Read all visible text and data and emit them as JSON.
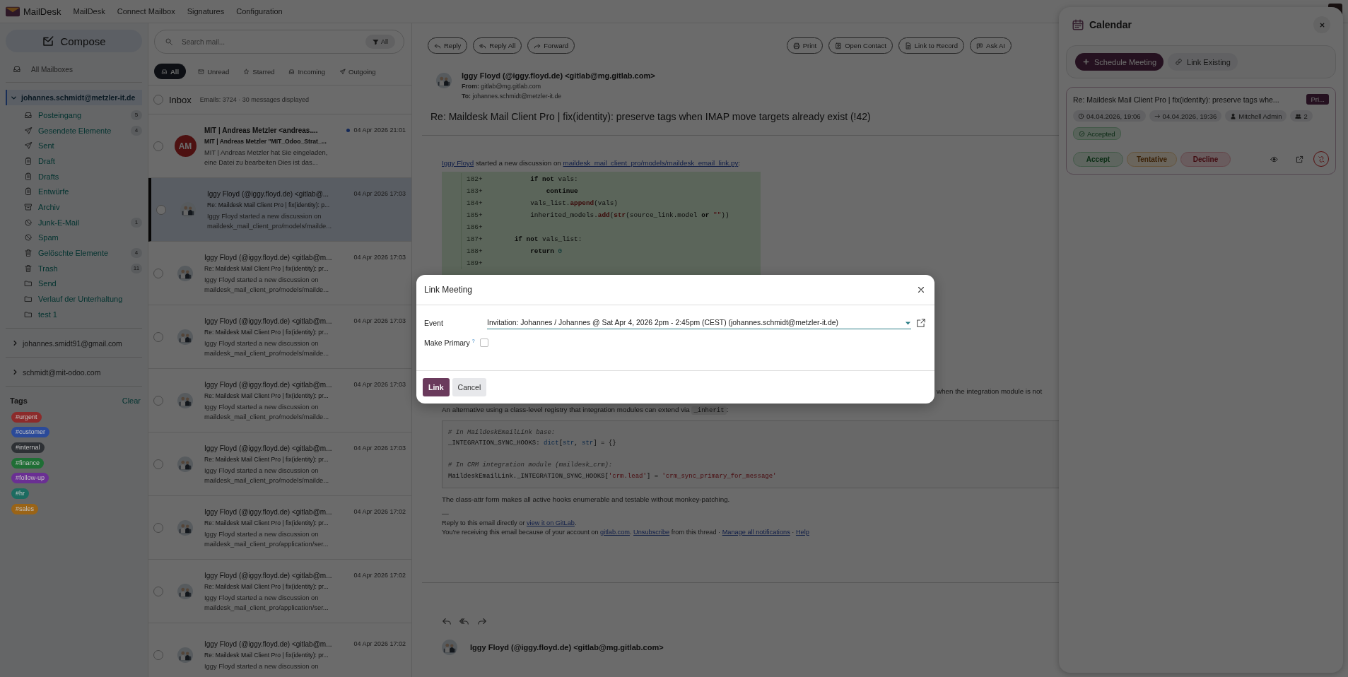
{
  "app": {
    "name": "MailDesk"
  },
  "nav": [
    {
      "label": "MailDesk"
    },
    {
      "label": "Connect Mailbox"
    },
    {
      "label": "Signatures"
    },
    {
      "label": "Configuration"
    }
  ],
  "sidebar": {
    "compose": "Compose",
    "all_mailboxes": "All Mailboxes",
    "accounts": [
      {
        "address": "johannes.schmidt@metzler-it.de",
        "expanded": true,
        "selected": true,
        "folders": [
          {
            "name": "Posteingang",
            "kind": "inbox",
            "count": "5"
          },
          {
            "name": "Gesendete Elemente",
            "kind": "sent",
            "count": "4"
          },
          {
            "name": "Sent",
            "kind": "sent"
          },
          {
            "name": "Draft",
            "kind": "drafts"
          },
          {
            "name": "Drafts",
            "kind": "drafts"
          },
          {
            "name": "Entwürfe",
            "kind": "drafts"
          },
          {
            "name": "Archiv",
            "kind": "archive"
          },
          {
            "name": "Junk-E-Mail",
            "kind": "junk",
            "count": "1"
          },
          {
            "name": "Spam",
            "kind": "junk"
          },
          {
            "name": "Gelöschte Elemente",
            "kind": "trash",
            "count": "4"
          },
          {
            "name": "Trash",
            "kind": "trash",
            "count": "11"
          },
          {
            "name": "Send",
            "kind": "folder"
          },
          {
            "name": "Verlauf der Unterhaltung",
            "kind": "folder"
          },
          {
            "name": "test 1",
            "kind": "folder"
          }
        ]
      },
      {
        "address": "johannes.smidt91@gmail.com",
        "expanded": false,
        "selected": false
      },
      {
        "address": "schmidt@mit-odoo.com",
        "expanded": false,
        "selected": false
      }
    ],
    "tags_title": "Tags",
    "clear": "Clear",
    "tags": [
      {
        "label": "#urgent",
        "color": "#8c2b2b"
      },
      {
        "label": "#customer",
        "color": "#2b4a99"
      },
      {
        "label": "#internal",
        "color": "#2e3135"
      },
      {
        "label": "#finance",
        "color": "#1f6e35"
      },
      {
        "label": "#follow-up",
        "color": "#6a2f93"
      },
      {
        "label": "#hr",
        "color": "#1c6b60"
      },
      {
        "label": "#sales",
        "color": "#9a6417"
      }
    ]
  },
  "list": {
    "search": {
      "placeholder": "Search mail...",
      "filter": "All"
    },
    "filters": [
      {
        "label": "All",
        "kind": "all",
        "selected": true
      },
      {
        "label": "Unread",
        "kind": "unread",
        "selected": false
      },
      {
        "label": "Starred",
        "kind": "starred",
        "selected": false
      },
      {
        "label": "Incoming",
        "kind": "incoming",
        "selected": false
      },
      {
        "label": "Outgoing",
        "kind": "outgoing",
        "selected": false
      }
    ],
    "folder": "Inbox",
    "select_all": false,
    "summary": "Emails: 3724 · 30 messages displayed",
    "messages": [
      {
        "sender": "MIT | Andreas Metzler <andreas....",
        "date": "04 Apr 2026 21:01",
        "subject": "MIT | Andreas Metzler \"MIT_Odoo_Strat_...",
        "preview": [
          "MIT | Andreas Metzler hat Sie eingeladen,",
          "eine Datei zu bearbeiten Dies ist das..."
        ],
        "kind": "initials",
        "initials": "AM",
        "unread": true,
        "selected": false,
        "checked": false
      },
      {
        "sender": "Iggy Floyd (@iggy.floyd.de) <gitlab@...",
        "date": "04 Apr 2026 17:03",
        "subject": "Re: Maildesk Mail Client Pro | fix(identity): p...",
        "preview": [
          "Iggy Floyd started a new discussion on",
          "maildesk_mail_client_pro/models/mailde..."
        ],
        "unread": false,
        "selected": true,
        "checked": false
      },
      {
        "sender": "Iggy Floyd (@iggy.floyd.de) <gitlab@m...",
        "date": "04 Apr 2026 17:03",
        "subject": "Re: Maildesk Mail Client Pro | fix(identity): pr...",
        "preview": [
          "Iggy Floyd started a new discussion on",
          "maildesk_mail_client_pro/models/mailde..."
        ],
        "unread": false,
        "selected": false,
        "checked": false
      },
      {
        "sender": "Iggy Floyd (@iggy.floyd.de) <gitlab@m...",
        "date": "04 Apr 2026 17:03",
        "subject": "Re: Maildesk Mail Client Pro | fix(identity): pr...",
        "preview": [
          "Iggy Floyd started a new discussion on",
          "maildesk_mail_client_pro/models/mailde..."
        ],
        "unread": false,
        "selected": false,
        "checked": false
      },
      {
        "sender": "Iggy Floyd (@iggy.floyd.de) <gitlab@m...",
        "date": "04 Apr 2026 17:03",
        "subject": "Re: Maildesk Mail Client Pro | fix(identity): pr...",
        "preview": [
          "Iggy Floyd started a new discussion on",
          "maildesk_mail_client_pro/models/mailde..."
        ],
        "unread": false,
        "selected": false,
        "checked": false
      },
      {
        "sender": "Iggy Floyd (@iggy.floyd.de) <gitlab@m...",
        "date": "04 Apr 2026 17:03",
        "subject": "Re: Maildesk Mail Client Pro | fix(identity): pr...",
        "preview": [
          "Iggy Floyd started a new discussion on",
          "maildesk_mail_client_pro/models/mailde..."
        ],
        "unread": false,
        "selected": false,
        "checked": false
      },
      {
        "sender": "Iggy Floyd (@iggy.floyd.de) <gitlab@m...",
        "date": "04 Apr 2026 17:02",
        "subject": "Re: Maildesk Mail Client Pro | fix(identity): pr...",
        "preview": [
          "Iggy Floyd started a new discussion on",
          "maildesk_mail_client_pro/application/ser..."
        ],
        "unread": false,
        "selected": false,
        "checked": false
      },
      {
        "sender": "Iggy Floyd (@iggy.floyd.de) <gitlab@m...",
        "date": "04 Apr 2026 17:02",
        "subject": "Re: Maildesk Mail Client Pro | fix(identity): pr...",
        "preview": [
          "Iggy Floyd started a new discussion on",
          "maildesk_mail_client_pro/application/ser..."
        ],
        "unread": false,
        "selected": false,
        "checked": false
      },
      {
        "sender": "Iggy Floyd (@iggy.floyd.de) <gitlab@m...",
        "date": "04 Apr 2026 17:02",
        "subject": "Re: Maildesk Mail Client Pro | fix(identity): pr...",
        "preview": [
          "Iggy Floyd started a new discussion on"
        ],
        "unread": false,
        "selected": false,
        "checked": false
      }
    ]
  },
  "email": {
    "actions_left": [
      {
        "label": "Reply",
        "kind": "reply"
      },
      {
        "label": "Reply All",
        "kind": "reply_all"
      },
      {
        "label": "Forward",
        "kind": "forward"
      }
    ],
    "actions_right": [
      {
        "label": "Print",
        "kind": "print"
      },
      {
        "label": "Open Contact",
        "kind": "contact"
      },
      {
        "label": "Link to Record",
        "kind": "record"
      },
      {
        "label": "Ask AI",
        "kind": "ai"
      }
    ],
    "sender": "Iggy Floyd (@iggy.floyd.de) <gitlab@mg.gitlab.com>",
    "from": "**From:** gitlab@mg.gitlab.com",
    "to": "**To:** johannes.schmidt@metzler-it.de",
    "subject": "Re: Maildesk Mail Client Pro | fix(identity): preserve tags when IMAP move targets already exist (!42)",
    "intro": [
      {
        "text": "Iggy Floyd",
        "link": true
      },
      {
        "text": " started a new discussion on ",
        "link": false
      },
      {
        "text": "maildesk_mail_client_pro/models/maildesk_email_link.py",
        "link": true
      },
      {
        "text": ":",
        "link": false
      }
    ],
    "diff": [
      {
        "num": "182",
        "sign": "+",
        "tokens": [
          {
            "text": "            if not",
            "kind": "kw"
          },
          {
            "text": " vals:",
            "kind": "plain"
          }
        ]
      },
      {
        "num": "183",
        "sign": "+",
        "tokens": [
          {
            "text": "                continue",
            "kind": "kw"
          }
        ]
      },
      {
        "num": "184",
        "sign": "+",
        "tokens": [
          {
            "text": "            vals_list.",
            "kind": "plain"
          },
          {
            "text": "append",
            "kind": "fn"
          },
          {
            "text": "(vals)",
            "kind": "plain"
          }
        ]
      },
      {
        "num": "185",
        "sign": "+",
        "tokens": [
          {
            "text": "            inherited_models.",
            "kind": "plain"
          },
          {
            "text": "add",
            "kind": "fn"
          },
          {
            "text": "(",
            "kind": "plain"
          },
          {
            "text": "str",
            "kind": "fn"
          },
          {
            "text": "(source_link.model ",
            "kind": "plain"
          },
          {
            "text": "or ",
            "kind": "kw"
          },
          {
            "text": "\"\"",
            "kind": "str"
          },
          {
            "text": "))",
            "kind": "plain"
          }
        ]
      },
      {
        "num": "186",
        "sign": "+"
      },
      {
        "num": "187",
        "sign": "+",
        "tokens": [
          {
            "text": "        if not",
            "kind": "kw"
          },
          {
            "text": " vals_list:",
            "kind": "plain"
          }
        ]
      },
      {
        "num": "188",
        "sign": "+",
        "tokens": [
          {
            "text": "            return ",
            "kind": "kw"
          },
          {
            "text": "0",
            "kind": "num"
          }
        ]
      },
      {
        "num": "189",
        "sign": "+"
      }
    ],
    "cut_line": "when the integration module is not",
    "paragraph": [
      {
        "text": "An alternative using a class-level registry that integration modules can extend via ",
        "kind": "text"
      },
      {
        "text": "_inherit",
        "kind": "code"
      },
      {
        "text": ":",
        "kind": "text"
      }
    ],
    "code": [
      {
        "kind": "code",
        "tokens": [
          {
            "text": "# In MaildeskEmailLink base:",
            "kind": "cm"
          }
        ]
      },
      {
        "kind": "code",
        "tokens": [
          {
            "text": "_INTEGRATION_SYNC_HOOKS: ",
            "kind": "plain"
          },
          {
            "text": "dict",
            "kind": "bi"
          },
          {
            "text": "[",
            "kind": "plain"
          },
          {
            "text": "str",
            "kind": "bi"
          },
          {
            "text": ", ",
            "kind": "plain"
          },
          {
            "text": "str",
            "kind": "bi"
          },
          {
            "text": "] = {}",
            "kind": "plain"
          }
        ]
      },
      {
        "kind": "blank"
      },
      {
        "kind": "code",
        "tokens": [
          {
            "text": "# In CRM integration module (maildesk_crm):",
            "kind": "cm"
          }
        ]
      },
      {
        "kind": "code",
        "tokens": [
          {
            "text": "MaildeskEmailLink._INTEGRATION_SYNC_HOOKS[",
            "kind": "plain"
          },
          {
            "text": "'crm.lead'",
            "kind": "str"
          },
          {
            "text": "] = ",
            "kind": "plain"
          },
          {
            "text": "'crm_sync_primary_for_message'",
            "kind": "str"
          }
        ]
      }
    ],
    "closing": "The class-attr form makes all active hooks enumerable and testable without monkey-patching.",
    "separator": "—",
    "footer": [
      [
        {
          "text": "Reply to this email directly or ",
          "link": false
        },
        {
          "text": "view it on GitLab",
          "link": true
        },
        {
          "text": ".",
          "link": false
        }
      ],
      [
        {
          "text": "You're receiving this email because of your account on ",
          "link": false
        },
        {
          "text": "gitlab.com",
          "link": true
        },
        {
          "text": ". ",
          "link": false
        },
        {
          "text": "Unsubscribe",
          "link": true
        },
        {
          "text": " from this thread · ",
          "link": false
        },
        {
          "text": "Manage all notifications",
          "link": true
        },
        {
          "text": " · ",
          "link": false
        },
        {
          "text": "Help",
          "link": true
        }
      ]
    ],
    "reply_icons": [
      {
        "kind": "reply"
      },
      {
        "kind": "reply_all"
      },
      {
        "kind": "forward"
      }
    ],
    "next_message": {
      "sender": "Iggy Floyd (@iggy.floyd.de) <gitlab@mg.gitlab.com>"
    }
  },
  "modal": {
    "title": "Link Meeting",
    "event_label": "Event",
    "event_value": "Invitation: Johannes / Johannes @ Sat Apr 4, 2026 2pm - 2:45pm (CEST) (johannes.schmidt@metzler-it.de)",
    "primary_label": "Make Primary",
    "help": "?",
    "primary_checked": false,
    "buttons": [
      {
        "label": "Link",
        "kind": "primary"
      },
      {
        "label": "Cancel",
        "kind": "secondary"
      }
    ]
  },
  "calendar": {
    "title": "Calendar",
    "actions": [
      {
        "label": "Schedule Meeting",
        "kind": "schedule"
      },
      {
        "label": "Link Existing",
        "kind": "link"
      }
    ],
    "event": {
      "title": "Re: Maildesk Mail Client Pro | fix(identity): preserve tags whe...",
      "badge": "Pri...",
      "chips": [
        {
          "kind": "start",
          "text": "04.04.2026, 19:06"
        },
        {
          "kind": "end",
          "text": "04.04.2026, 19:36"
        },
        {
          "kind": "organizer",
          "text": "Mitchell Admin"
        },
        {
          "kind": "attendees",
          "text": "2"
        }
      ],
      "status": {
        "kind": "accepted",
        "label": "Accepted"
      },
      "responses": [
        {
          "label": "Accept",
          "kind": "accept"
        },
        {
          "label": "Tentative",
          "kind": "tentative"
        },
        {
          "label": "Decline",
          "kind": "decline"
        }
      ],
      "tools": [
        {
          "kind": "view"
        },
        {
          "kind": "open"
        },
        {
          "kind": "unlink"
        }
      ]
    }
  }
}
